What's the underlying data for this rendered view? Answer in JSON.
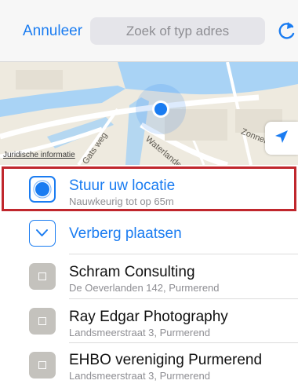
{
  "header": {
    "cancel_label": "Annuleer",
    "search_placeholder": "Zoek of typ adres",
    "reload_icon": "reload-icon"
  },
  "map": {
    "street_labels": [
      "Zonnelaan",
      "Waterlander",
      "Jurisdische",
      "Gats weg"
    ],
    "legal_link": "Juridische informatie",
    "locate_icon": "location-arrow-icon",
    "colors": {
      "water": "#a9d3f5",
      "land": "#eeeadf",
      "road": "#ffffff",
      "pin": "#1a7cf1"
    }
  },
  "options": [
    {
      "title": "Stuur uw locatie",
      "subtitle": "Nauwkeurig tot op 65m",
      "icon": "current-location-icon",
      "highlighted": true
    },
    {
      "title": "Verberg plaatsen",
      "icon": "chevron-down-icon"
    }
  ],
  "places": [
    {
      "name": "Schram Consulting",
      "address": "De Oeverlanden 142, Purmerend",
      "icon": "place-icon"
    },
    {
      "name": "Ray Edgar Photography",
      "address": "Landsmeerstraat 3, Purmerend",
      "icon": "place-icon"
    },
    {
      "name": "EHBO vereniging Purmerend",
      "address": "Landsmeerstraat 3, Purmerend",
      "icon": "place-icon"
    }
  ],
  "colors": {
    "accent": "#1a7cf1",
    "highlight_border": "#c0272d",
    "place_icon_bg": "#c4c2bd"
  }
}
